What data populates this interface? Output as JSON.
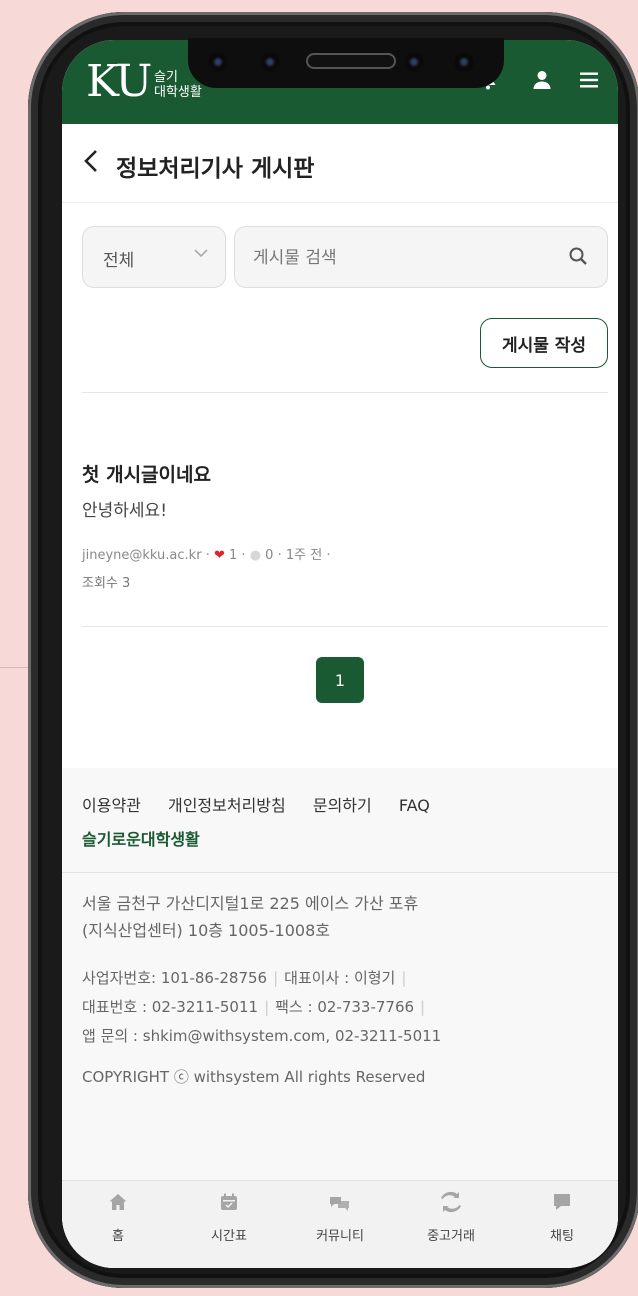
{
  "header": {
    "logo_main": "KU",
    "logo_sub_line1": "슬기",
    "logo_sub_line2": "대학생활"
  },
  "board": {
    "back_icon": "chevron-left-icon",
    "title": "정보처리기사 게시판"
  },
  "search": {
    "category_value": "전체",
    "placeholder": "게시물 검색",
    "value": ""
  },
  "write_button": "게시물 작성",
  "post": {
    "title": "첫 개시글이네요",
    "body": "안녕하세요!",
    "author": "jineyne@kku.ac.kr",
    "likes": "1",
    "comments": "0",
    "time": "1주 전",
    "views": "조회수 3"
  },
  "pagination": {
    "current": "1"
  },
  "footer": {
    "links": [
      "이용약관",
      "개인정보처리방침",
      "문의하기",
      "FAQ"
    ],
    "brand": "슬기로운대학생활",
    "address_line1": "서울 금천구 가산디지털1로 225 에이스 가산 포휴",
    "address_line2": "(지식산업센터) 10층 1005-1008호",
    "biz_number": "사업자번호: 101-86-28756",
    "ceo": "대표이사 : 이형기",
    "phone": "대표번호 : 02-3211-5011",
    "fax": "팩스 : 02-733-7766",
    "app_contact": "앱 문의 : shkim@withsystem.com, 02-3211-5011",
    "copyright": "COPYRIGHT ⓒ withsystem All rights Reserved"
  },
  "bottom_nav": [
    {
      "label": "홈",
      "icon": "home-icon"
    },
    {
      "label": "시간표",
      "icon": "calendar-icon"
    },
    {
      "label": "커뮤니티",
      "icon": "community-icon"
    },
    {
      "label": "중고거래",
      "icon": "trade-icon"
    },
    {
      "label": "채팅",
      "icon": "chat-icon"
    }
  ],
  "colors": {
    "brand_green": "#195a32",
    "background_pink": "#f7d9d8",
    "heart_red": "#e0242f"
  }
}
